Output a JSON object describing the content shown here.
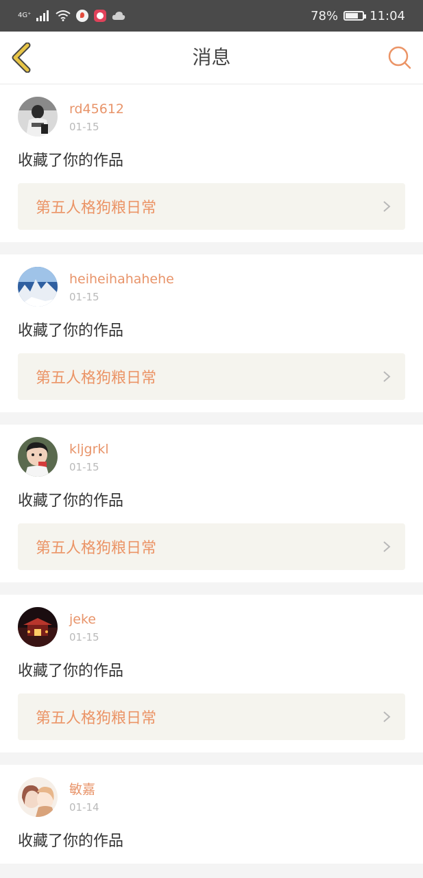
{
  "status_bar": {
    "network": "4G⁺",
    "battery_percent": "78%",
    "battery_level": 0.78,
    "time": "11:04"
  },
  "header": {
    "title": "消息",
    "back_icon": "back-arrow-icon",
    "search_icon": "search-icon"
  },
  "messages": [
    {
      "username": "rd45612",
      "date": "01-15",
      "action": "收藏了你的作品",
      "work_title": "第五人格狗粮日常"
    },
    {
      "username": "heiheihahahehe",
      "date": "01-15",
      "action": "收藏了你的作品",
      "work_title": "第五人格狗粮日常"
    },
    {
      "username": "kljgrkl",
      "date": "01-15",
      "action": "收藏了你的作品",
      "work_title": "第五人格狗粮日常"
    },
    {
      "username": "jeke",
      "date": "01-15",
      "action": "收藏了你的作品",
      "work_title": "第五人格狗粮日常"
    },
    {
      "username": "敏嘉",
      "date": "01-14",
      "action": "收藏了你的作品",
      "work_title": ""
    }
  ],
  "colors": {
    "accent": "#eb9466",
    "back_arrow": "#e8c547",
    "status_bar_bg": "#4a4a4a"
  }
}
